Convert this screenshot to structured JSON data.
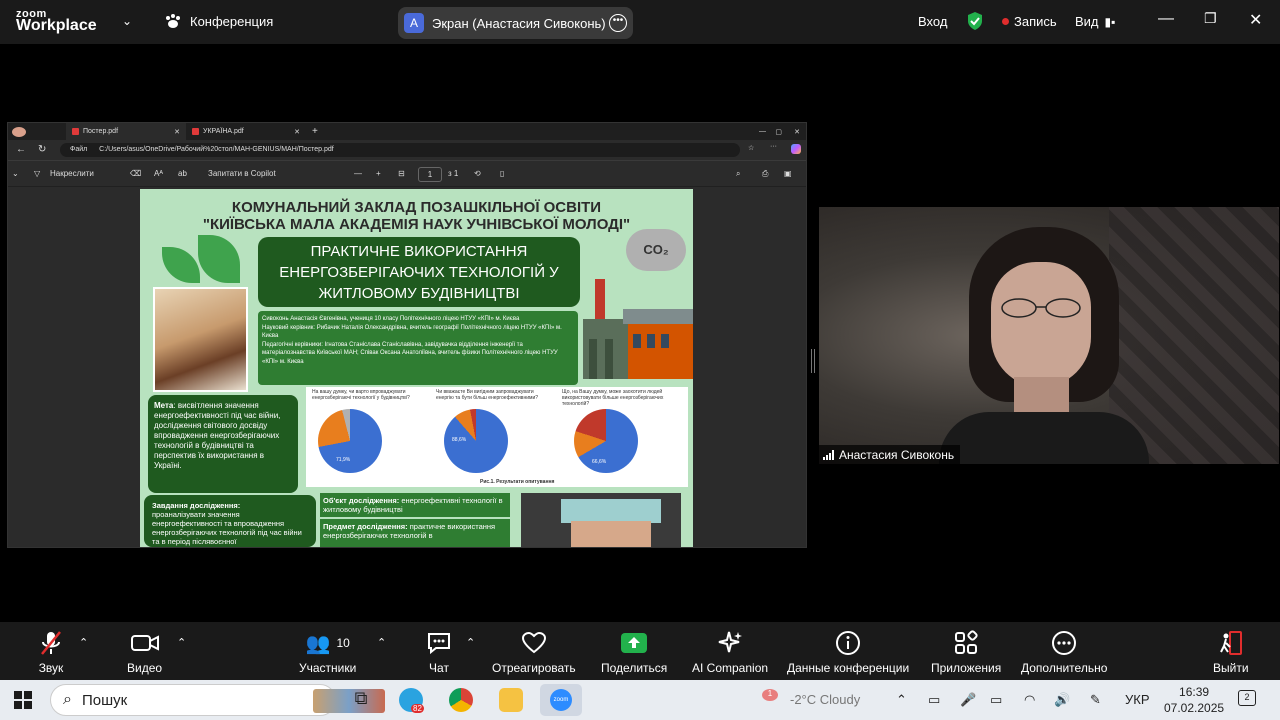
{
  "app": {
    "logo_line1": "zoom",
    "logo_line2": "Workplace"
  },
  "topbar": {
    "conference_label": "Конференция",
    "share_avatar_letter": "A",
    "share_label": "Экран (Анастасия Сивоконь)",
    "enter_label": "Вход",
    "record_label": "Запись",
    "view_label": "Вид"
  },
  "browser": {
    "tab1": "Постер.pdf",
    "tab2": "УКРАЇНА.pdf",
    "address_prefix": "Файл",
    "address": "C:/Users/asus/OneDrive/Рабочий%20стол/MAH-GENIUS/MAH/Постер.pdf",
    "draw_label": "Накреслити",
    "copilot_label": "Запитати в Copilot",
    "page_number": "1",
    "page_total": "з 1"
  },
  "poster": {
    "header": "КОМУНАЛЬНИЙ ЗАКЛАД ПОЗАШКІЛЬНОЇ ОСВІТИ\n\"КИЇВСЬКА МАЛА АКАДЕМІЯ НАУК УЧНІВСЬКОЇ МОЛОДІ\"",
    "title": "ПРАКТИЧНЕ ВИКОРИСТАННЯ ЕНЕРГОЗБЕРІГАЮЧИХ ТЕХНОЛОГІЙ У ЖИТЛОВОМУ БУДІВНИЦТВІ",
    "co2": "CO₂",
    "authors": "Сивоконь Анастасія Євгенівна, учениця 10 класу Політехнічного ліцею НТУУ «КПІ» м. Києва\nНауковий керівник: Рибачик Наталія Олександрівна, вчитель географії Політехнічного ліцею НТУУ «КПІ» м. Києва\nПедагогічні керівники: Ігнатова Станіслава Станіславівна, завідувачка відділення інженерії та матеріалознавства Київської МАН; Співак Оксана Анатоліївна, вчитель фізики Політехнічного ліцею НТУУ «КПІ» м. Києва",
    "aim_label": "Мета",
    "aim_text": ": висвітлення значення енергоефективності під час війни, дослідження світового досвіду впровадження енергозберігаючих технологій в будівництві та перспектив їх використання в Україні.",
    "q1": "На вашу думку, чи варто впроваджувати енергозберігаючі технології у будівництві?",
    "q2": "Чи вважаєте Ви вигідним запроваджувати енергію та бути більш енергоефективними?",
    "q3": "Що, на Вашу думку, може заохотити людей використовувати більше енергозберігаючих технологій?",
    "caption": "Рис.1. Результати опитування",
    "pie1_label": "71,9%",
    "pie2_label": "88,6%",
    "pie3_label": "66,6%",
    "task_label": "Завдання дослідження:",
    "task_text": "проаналізувати значення енергоефективності та впровадження енергозберігаючих технологій під час війни та в період післявоєнної",
    "object_label": "Об'єкт дослідження:",
    "object_text": " енергоефективні технології в житловому будівництві",
    "subject_label": "Предмет дослідження:",
    "subject_text": " практичне використання енергозберігаючих технологій в"
  },
  "video": {
    "name": "Анастасия Сивоконь"
  },
  "controls": {
    "audio": "Звук",
    "video": "Видео",
    "participants": "Участники",
    "participants_count": "10",
    "chat": "Чат",
    "react": "Отреагировать",
    "share": "Поделиться",
    "ai": "AI Companion",
    "info": "Данные конференции",
    "apps": "Приложения",
    "more": "Дополнительно",
    "leave": "Выйти"
  },
  "taskbar": {
    "search_placeholder": "Пошук",
    "weather": "-2°C  Cloudy",
    "weather_badge": "1",
    "lang": "УКР",
    "time": "16:39",
    "date": "07.02.2025",
    "notif_count": "2",
    "telegram_badge": "82"
  },
  "colors": {
    "poster_bg": "#b8e2bf",
    "poster_dark": "#1f5a1f",
    "accent_green": "#22b14c",
    "topbar": "#1a1a1a"
  }
}
